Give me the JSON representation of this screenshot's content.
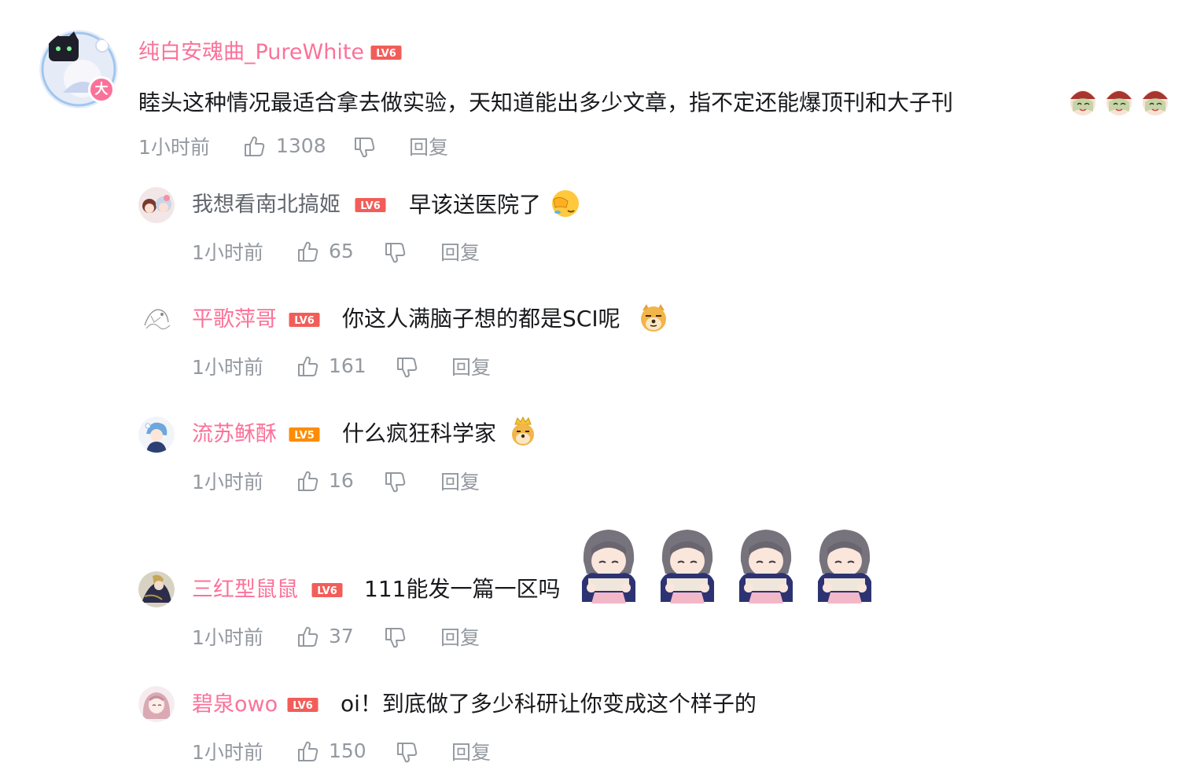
{
  "colors": {
    "vip_pink": "#fb7299",
    "meta_gray": "#9499a0",
    "text": "#18191c",
    "level_red": "#f25d59",
    "level_orange": "#ff8c00"
  },
  "main_comment": {
    "username": "纯白安魂曲_PureWhite",
    "level": "LV6",
    "badge": "大",
    "text": "睦头这种情况最适合拿去做实验，天知道能出多少文章，指不定还能爆顶刊和大子刊",
    "emojis": [
      "smile-girl-emoji",
      "smile-girl-emoji",
      "smile-girl-emoji"
    ],
    "time": "1小时前",
    "likes": "1308",
    "reply_label": "回复"
  },
  "replies": [
    {
      "username": "我想看南北搞姬",
      "level": "LV6",
      "text": "早该送医院了",
      "emoji": "facepalm-emoji",
      "time": "1小时前",
      "likes": "65",
      "reply_label": "回复"
    },
    {
      "username": "平歌萍哥",
      "level": "LV6",
      "text": "你这人满脑子想的都是SCI呢",
      "emoji": "doge-emoji",
      "time": "1小时前",
      "likes": "161",
      "reply_label": "回复"
    },
    {
      "username": "流苏稣酥",
      "level": "LV5",
      "text": "什么疯狂科学家",
      "emoji": "crowned-doge-emoji",
      "time": "1小时前",
      "likes": "16",
      "reply_label": "回复"
    },
    {
      "username": "三红型鼠鼠",
      "level": "LV6",
      "text": "111能发一篇一区吗",
      "stickers": [
        "hugging-knees-girl-sticker",
        "hugging-knees-girl-sticker",
        "hugging-knees-girl-sticker",
        "hugging-knees-girl-sticker"
      ],
      "time": "1小时前",
      "likes": "37",
      "reply_label": "回复"
    },
    {
      "username": "碧泉owo",
      "level": "LV6",
      "text": "oi！到底做了多少科研让你变成这个样子的",
      "time": "1小时前",
      "likes": "150",
      "reply_label": "回复"
    }
  ]
}
